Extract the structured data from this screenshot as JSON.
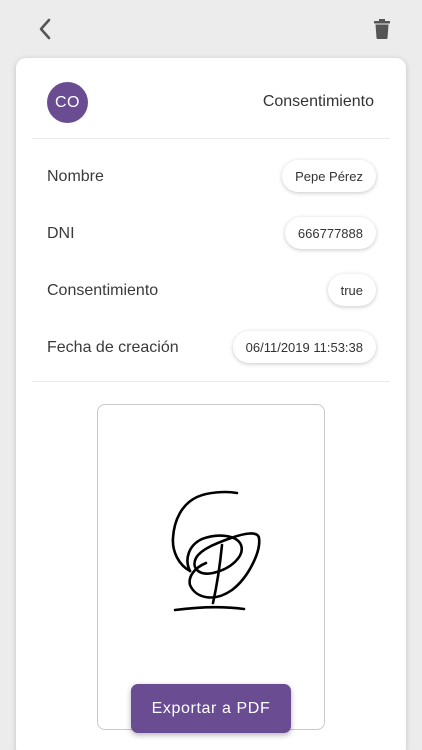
{
  "nav": {
    "back_icon": "chevron-left-icon",
    "delete_icon": "trash-icon"
  },
  "header": {
    "avatar_initials": "CO",
    "title": "Consentimiento"
  },
  "fields": [
    {
      "label": "Nombre",
      "value": "Pepe Pérez"
    },
    {
      "label": "DNI",
      "value": "666777888"
    },
    {
      "label": "Consentimiento",
      "value": "true"
    },
    {
      "label": "Fecha de creación",
      "value": "06/11/2019 11:53:38"
    }
  ],
  "signature": {
    "icon": "handwritten-signature"
  },
  "actions": {
    "export_label": "Exportar a PDF"
  },
  "colors": {
    "accent": "#6a4c93",
    "background": "#ececec",
    "card": "#ffffff"
  }
}
